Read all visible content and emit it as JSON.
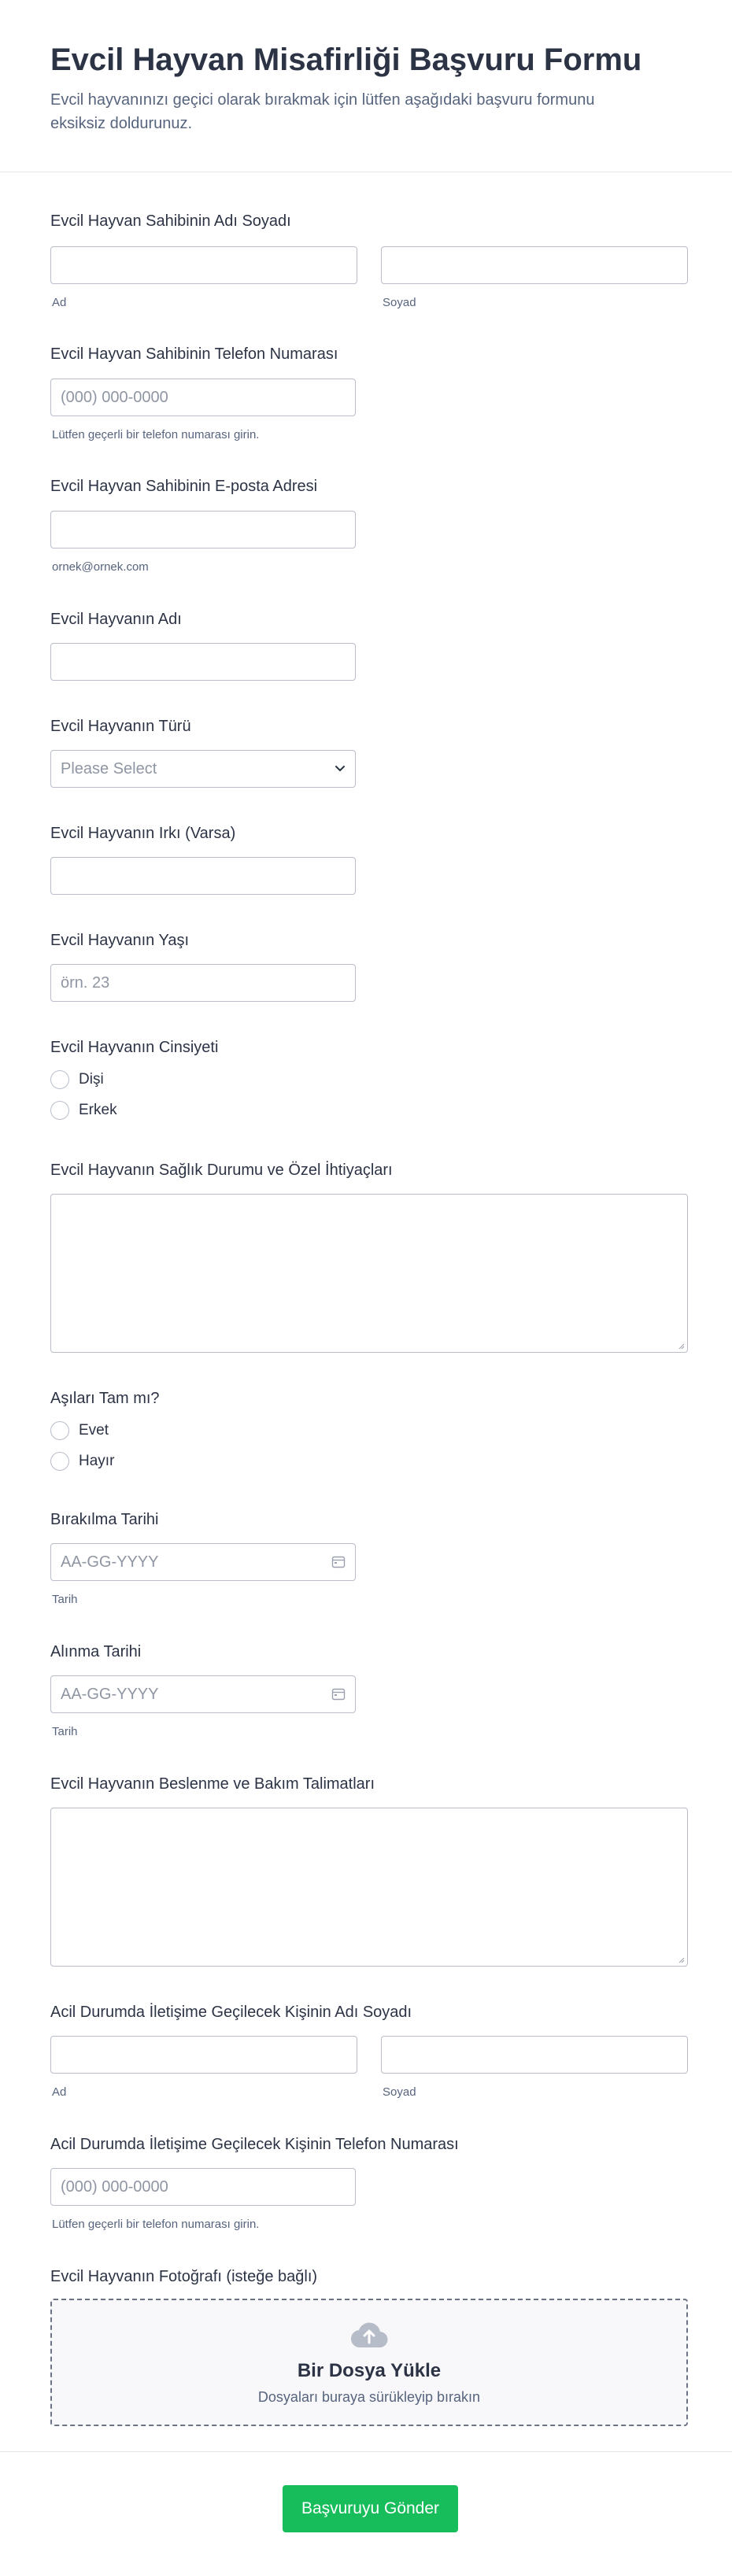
{
  "form": {
    "title": "Evcil Hayvan Misafirliği Başvuru Formu",
    "description": "Evcil hayvanınızı geçici olarak bırakmak için lütfen aşağıdaki başvuru formunu eksiksiz doldurunuz."
  },
  "owner_name": {
    "label": "Evcil Hayvan Sahibinin Adı Soyadı",
    "first_sub": "Ad",
    "last_sub": "Soyad"
  },
  "owner_phone": {
    "label": "Evcil Hayvan Sahibinin Telefon Numarası",
    "placeholder": "(000) 000-0000",
    "sub": "Lütfen geçerli bir telefon numarası girin."
  },
  "owner_email": {
    "label": "Evcil Hayvan Sahibinin E-posta Adresi",
    "sub": "ornek@ornek.com"
  },
  "pet_name": {
    "label": "Evcil Hayvanın Adı"
  },
  "pet_type": {
    "label": "Evcil Hayvanın Türü",
    "selected": "Please Select"
  },
  "pet_breed": {
    "label": "Evcil Hayvanın Irkı (Varsa)"
  },
  "pet_age": {
    "label": "Evcil Hayvanın Yaşı",
    "placeholder": "örn. 23"
  },
  "pet_gender": {
    "label": "Evcil Hayvanın Cinsiyeti",
    "options": [
      "Dişi",
      "Erkek"
    ]
  },
  "pet_health": {
    "label": "Evcil Hayvanın Sağlık Durumu ve Özel İhtiyaçları"
  },
  "vaccines": {
    "label": "Aşıları Tam mı?",
    "options": [
      "Evet",
      "Hayır"
    ]
  },
  "dropoff_date": {
    "label": "Bırakılma Tarihi",
    "placeholder": "AA-GG-YYYY",
    "sub": "Tarih"
  },
  "pickup_date": {
    "label": "Alınma Tarihi",
    "placeholder": "AA-GG-YYYY",
    "sub": "Tarih"
  },
  "care_instructions": {
    "label": "Evcil Hayvanın Beslenme ve Bakım Talimatları"
  },
  "emergency_name": {
    "label": "Acil Durumda İletişime Geçilecek Kişinin Adı Soyadı",
    "first_sub": "Ad",
    "last_sub": "Soyad"
  },
  "emergency_phone": {
    "label": "Acil Durumda İletişime Geçilecek Kişinin Telefon Numarası",
    "placeholder": "(000) 000-0000",
    "sub": "Lütfen geçerli bir telefon numarası girin."
  },
  "pet_photo": {
    "label": "Evcil Hayvanın Fotoğrafı (isteğe bağlı)",
    "upload_title": "Bir Dosya Yükle",
    "upload_hint": "Dosyaları buraya sürükleyip bırakın"
  },
  "submit_label": "Başvuruyu Gönder",
  "colors": {
    "accent": "#18bd5b",
    "text": "#2c3345",
    "border": "#b8bdc9"
  },
  "icons": [
    "chevron-down-icon",
    "calendar-icon",
    "upload-cloud-icon"
  ]
}
